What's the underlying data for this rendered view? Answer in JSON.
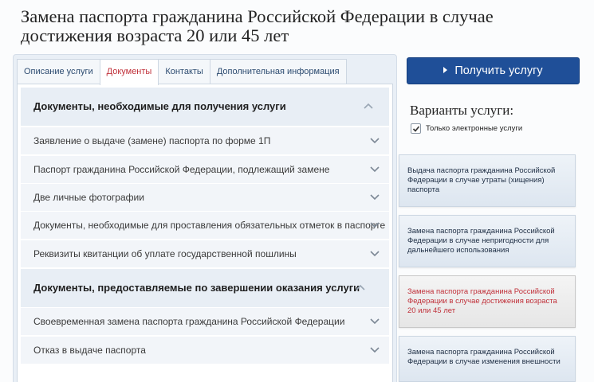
{
  "page_title": "Замена паспорта гражданина Российской Федерации в случае достижения возраста 20 или 45 лет",
  "tabs": [
    {
      "label": "Описание услуги",
      "active": false
    },
    {
      "label": "Документы",
      "active": true
    },
    {
      "label": "Контакты",
      "active": false
    },
    {
      "label": "Дополнительная информация",
      "active": false
    }
  ],
  "sections": [
    {
      "title": "Документы, необходимые для получения услуги",
      "items": [
        "Заявление о выдаче (замене) паспорта по форме 1П",
        "Паспорт гражданина Российской Федерации, подлежащий замене",
        "Две личные фотографии",
        "Документы, необходимые для проставления обязательных отметок в паспорте",
        "Реквизиты квитанции об уплате государственной пошлины"
      ]
    },
    {
      "title": "Документы, предоставляемые по завершении оказания услуги",
      "items": [
        "Своевременная замена паспорта гражданина Российской Федерации",
        "Отказ в выдаче паспорта"
      ]
    }
  ],
  "get_service_label": "Получить услугу",
  "variants": {
    "title": "Варианты услуги:",
    "checkbox_label": "Только электронные услуги",
    "checkbox_checked": true,
    "cards": [
      {
        "text": "Выдача паспорта гражданина Российской Федерации в случае утраты (хищения) паспорта",
        "active": false
      },
      {
        "text": "Замена паспорта гражданина Российской Федерации в случае непригодности для дальнейшего использования",
        "active": false
      },
      {
        "text": "Замена паспорта гражданина Российской Федерации в случае достижения возраста 20 или 45 лет",
        "active": true
      },
      {
        "text": "Замена паспорта гражданина Российской Федерации в случае изменения внешности",
        "active": false
      }
    ]
  },
  "colors": {
    "accent_red": "#c0313a",
    "button_blue": "#1f4f98",
    "tab_link": "#2c4b70"
  },
  "icons": [
    "chevron-up-icon",
    "chevron-down-icon",
    "play-arrow-icon",
    "checkmark-icon"
  ]
}
